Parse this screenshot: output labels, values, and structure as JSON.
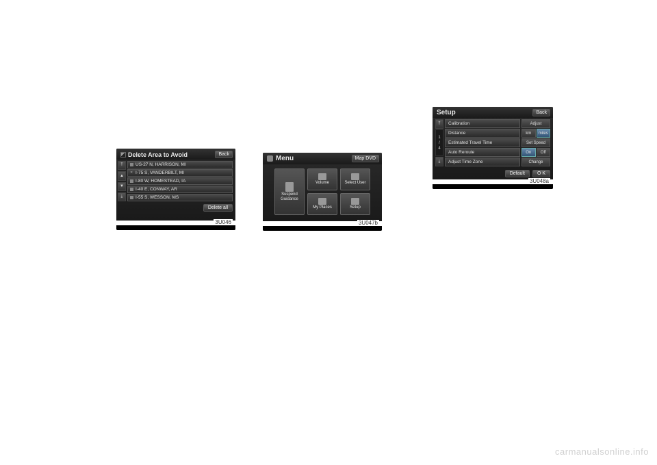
{
  "watermark": "carmanualsonline.info",
  "screen1": {
    "title": "Delete Area to Avoid",
    "back": "Back",
    "items": [
      "US-27 N, HARRISON, MI",
      "I-75 S, VANDERBILT, MI",
      "I-80 W, HOMESTEAD, IA",
      "I-40 E, CONWAY, AR",
      "I-55 S, WESSON, MS"
    ],
    "delete_all": "Delete all",
    "figref": "3U046"
  },
  "screen2": {
    "title": "Menu",
    "map_dvd": "Map DVD",
    "tiles": {
      "suspend": "Suspend\nGuidance",
      "volume": "Volume",
      "select_user": "Select User",
      "my_places": "My Places",
      "setup": "Setup"
    },
    "figref": "3U047b"
  },
  "screen3": {
    "title": "Setup",
    "back": "Back",
    "page": "1\n/\n4",
    "rows": {
      "calibration": {
        "label": "Calibration",
        "action": "Adjust"
      },
      "distance": {
        "label": "Distance",
        "opt1": "km",
        "opt2": "miles"
      },
      "travel": {
        "label": "Estimated Travel Time",
        "action": "Set Speed"
      },
      "reroute": {
        "label": "Auto Reroute",
        "opt1": "On",
        "opt2": "Off"
      },
      "timezone": {
        "label": "Adjust Time Zone",
        "action": "Change"
      }
    },
    "default": "Default",
    "ok": "O K",
    "figref": "3U048a"
  }
}
